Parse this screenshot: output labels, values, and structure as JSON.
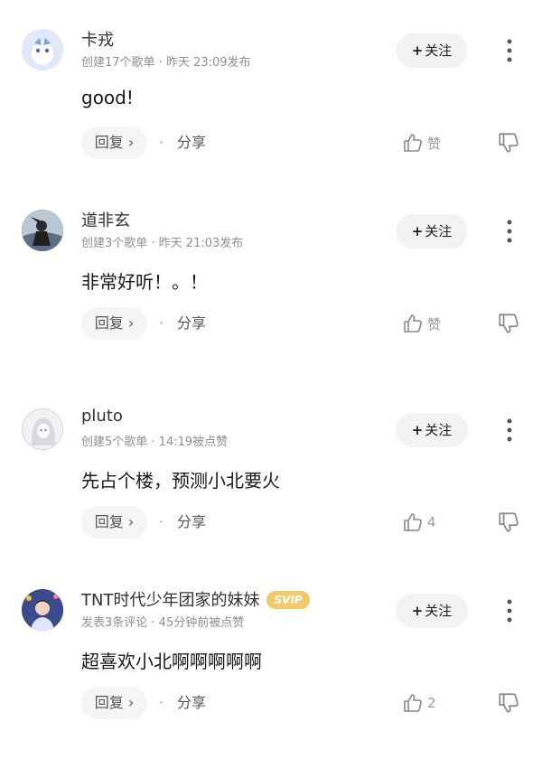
{
  "comments": [
    {
      "user": "卡戎",
      "meta": "创建17个歌单 · 昨天 23:09发布",
      "text": "good!",
      "follow_label": "关注",
      "reply_label": "回复 ›",
      "separator": "·",
      "share_label": "分享",
      "like_label": "赞"
    },
    {
      "user": "道非玄",
      "meta": "创建3个歌单 · 昨天 21:03发布",
      "text": "非常好听！。！",
      "follow_label": "关注",
      "reply_label": "回复 ›",
      "separator": "·",
      "share_label": "分享",
      "like_label": "赞"
    },
    {
      "user": "pluto",
      "meta": "创建5个歌单 · 14:19被点赞",
      "text": "先占个楼，预测小北要火",
      "follow_label": "关注",
      "reply_label": "回复 ›",
      "separator": "·",
      "share_label": "分享",
      "like_label": "4"
    },
    {
      "user": "TNT时代少年团家的妹妹",
      "badge": "SVIP",
      "meta": "发表3条评论 · 45分钟前被点赞",
      "text": "超喜欢小北啊啊啊啊啊",
      "follow_label": "关注",
      "reply_label": "回复 ›",
      "separator": "·",
      "share_label": "分享",
      "like_label": "2"
    }
  ],
  "colors": {
    "text": "#1a1a1a",
    "meta": "#8f8f8f",
    "button_bg": "#f3f3f3",
    "svip": "#f4c96a"
  }
}
